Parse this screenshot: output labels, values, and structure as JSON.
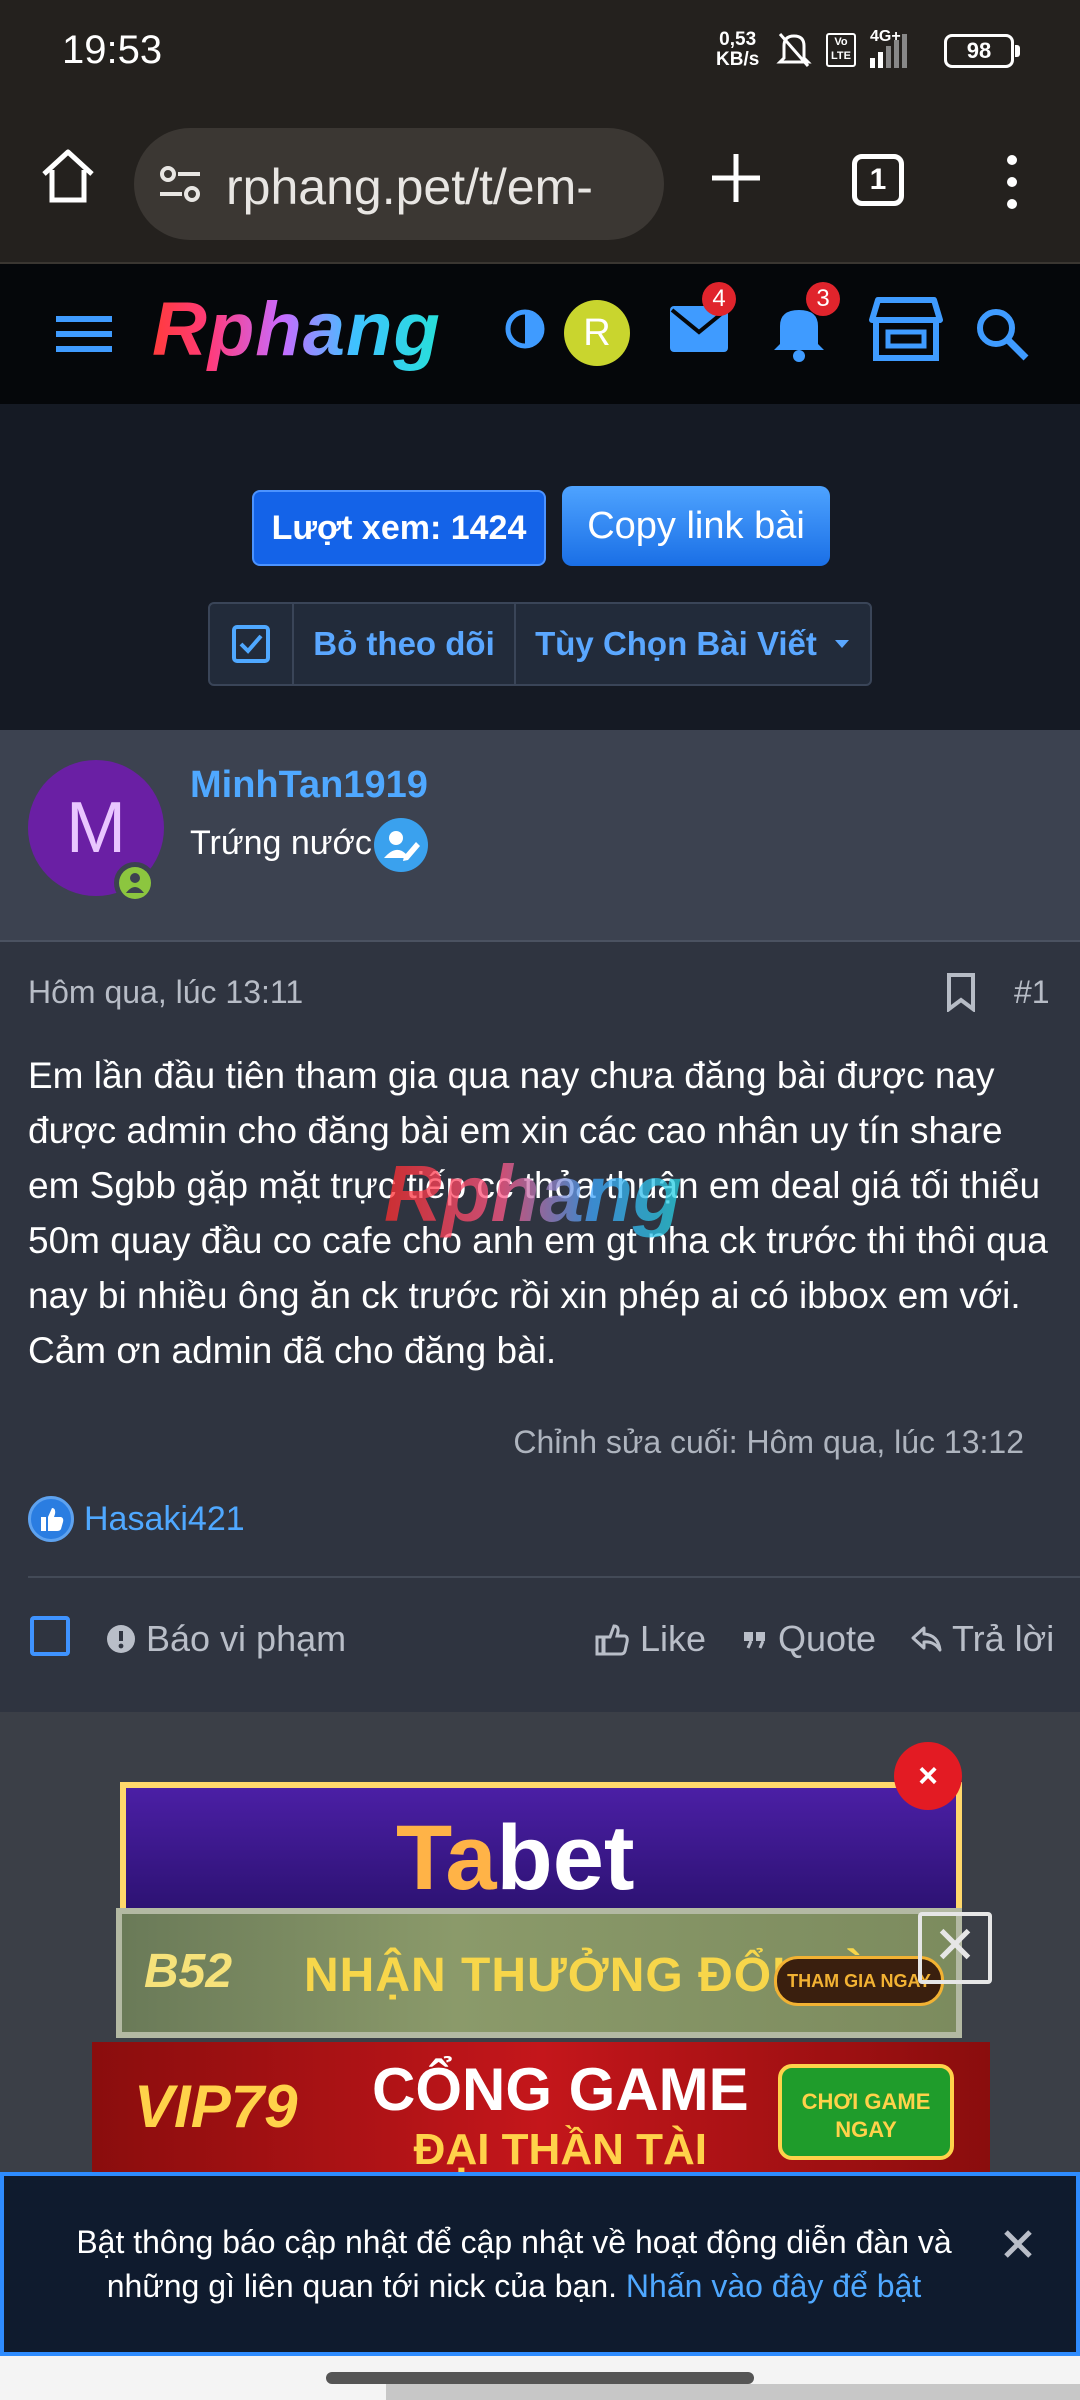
{
  "status_bar": {
    "time": "19:53",
    "speed_value": "0,53",
    "speed_unit": "KB/s",
    "volte": "Vo LTE",
    "network": "4G+",
    "battery": "98",
    "icons": [
      "bell-muted-icon",
      "volte-icon",
      "signal-icon"
    ]
  },
  "browser": {
    "url": "rphang.pet/t/em-",
    "tab_count": "1",
    "icons": [
      "home-icon",
      "site-settings-icon",
      "new-tab-icon",
      "tabs-icon",
      "menu-icon"
    ]
  },
  "site_header": {
    "logo": "Rphang",
    "user_avatar_letter": "R",
    "messages_badge": "4",
    "alerts_badge": "3",
    "colors": {
      "header_bg": "#05070a",
      "accent": "#3f9bff",
      "badge": "#e0242c"
    }
  },
  "thread_actions": {
    "views_label": "Lượt xem: 1424",
    "copy_link_label": "Copy link bài",
    "unfollow_label": "Bỏ theo dõi",
    "options_label": "Tùy Chọn Bài Viết"
  },
  "author": {
    "avatar_letter": "M",
    "username": "MinhTan1919",
    "user_title": "Trứng nước"
  },
  "post": {
    "date": "Hôm qua, lúc 13:11",
    "number": "#1",
    "body": "Em lần đầu tiên tham gia qua nay chưa đăng bài được nay được admin cho đăng bài em xin các cao nhân uy tín share em Sgbb gặp mặt trực tiếp cc thỏa thuận em deal giá tối thiểu 50m quay đầu co cafe cho anh em gt nha ck trước thi thôi qua nay bi nhiều ông ăn ck trước rồi xin phép ai có ibbox em với. Cảm ơn admin đã cho đăng bài.",
    "watermark": "Rphang",
    "edited": "Chỉnh sửa cuối: Hôm qua, lúc 13:12",
    "liked_by": "Hasaki421",
    "actions": {
      "report": "Báo vi phạm",
      "like": "Like",
      "quote": "Quote",
      "reply": "Trả lời"
    }
  },
  "ads": {
    "ad1_text_a": "Ta",
    "ad1_text_b": "bet",
    "ad2_brand": "B52",
    "ad2_text": "NHẬN THƯỞNG ĐỔI ĐỜI",
    "ad2_cta": "THAM GIA NGAY",
    "ad3_brand": "VIP79",
    "ad3_line1": "CỔNG GAME",
    "ad3_line2": "ĐẠI THẦN TÀI",
    "ad3_cta_line1": "CHƠI GAME",
    "ad3_cta_line2": "NGAY",
    "close_red": "×",
    "close_box": "✕"
  },
  "notification": {
    "text": "Bật thông báo cập nhật để cập nhật về hoạt động diễn đàn và những gì liên quan tới nick của bạn.",
    "link": "Nhấn vào đây để bật"
  }
}
